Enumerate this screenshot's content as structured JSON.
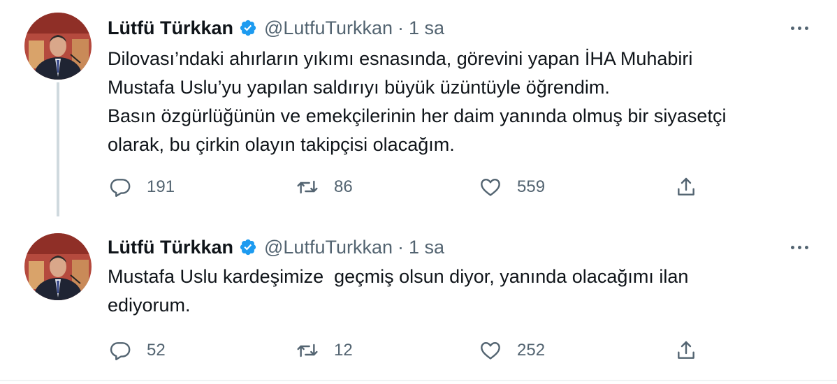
{
  "tweets": [
    {
      "author": {
        "name": "Lütfü Türkkan",
        "handle": "@LutfuTurkkan",
        "verified_icon": "verified-badge-icon"
      },
      "separator": "·",
      "time": "1 sa",
      "lines": [
        "Dilovası’ndaki ahırların yıkımı esnasında, görevini yapan İHA Muhabiri",
        "Mustafa Uslu’yu yapılan saldırıyı büyük üzüntüyle öğrendim.",
        "Basın özgürlüğünün ve emekçilerinin her daim yanında olmuş bir siyasetçi",
        "olarak, bu çirkin olayın takipçisi olacağım."
      ],
      "counts": {
        "replies": "191",
        "retweets": "86",
        "likes": "559"
      }
    },
    {
      "author": {
        "name": "Lütfü Türkkan",
        "handle": "@LutfuTurkkan",
        "verified_icon": "verified-badge-icon"
      },
      "separator": "·",
      "time": "1 sa",
      "lines": [
        "Mustafa Uslu kardeşimize  geçmiş olsun diyor, yanında olacağımı ilan",
        "ediyorum."
      ],
      "counts": {
        "replies": "52",
        "retweets": "12",
        "likes": "252"
      }
    }
  ],
  "icons": [
    "avatar",
    "verified-badge-icon",
    "more-icon",
    "reply-icon",
    "retweet-icon",
    "like-icon",
    "share-icon"
  ],
  "colors": {
    "text": "#0f1419",
    "secondary": "#536471",
    "verified": "#1d9bf0",
    "thread_line": "#cfd9de"
  }
}
